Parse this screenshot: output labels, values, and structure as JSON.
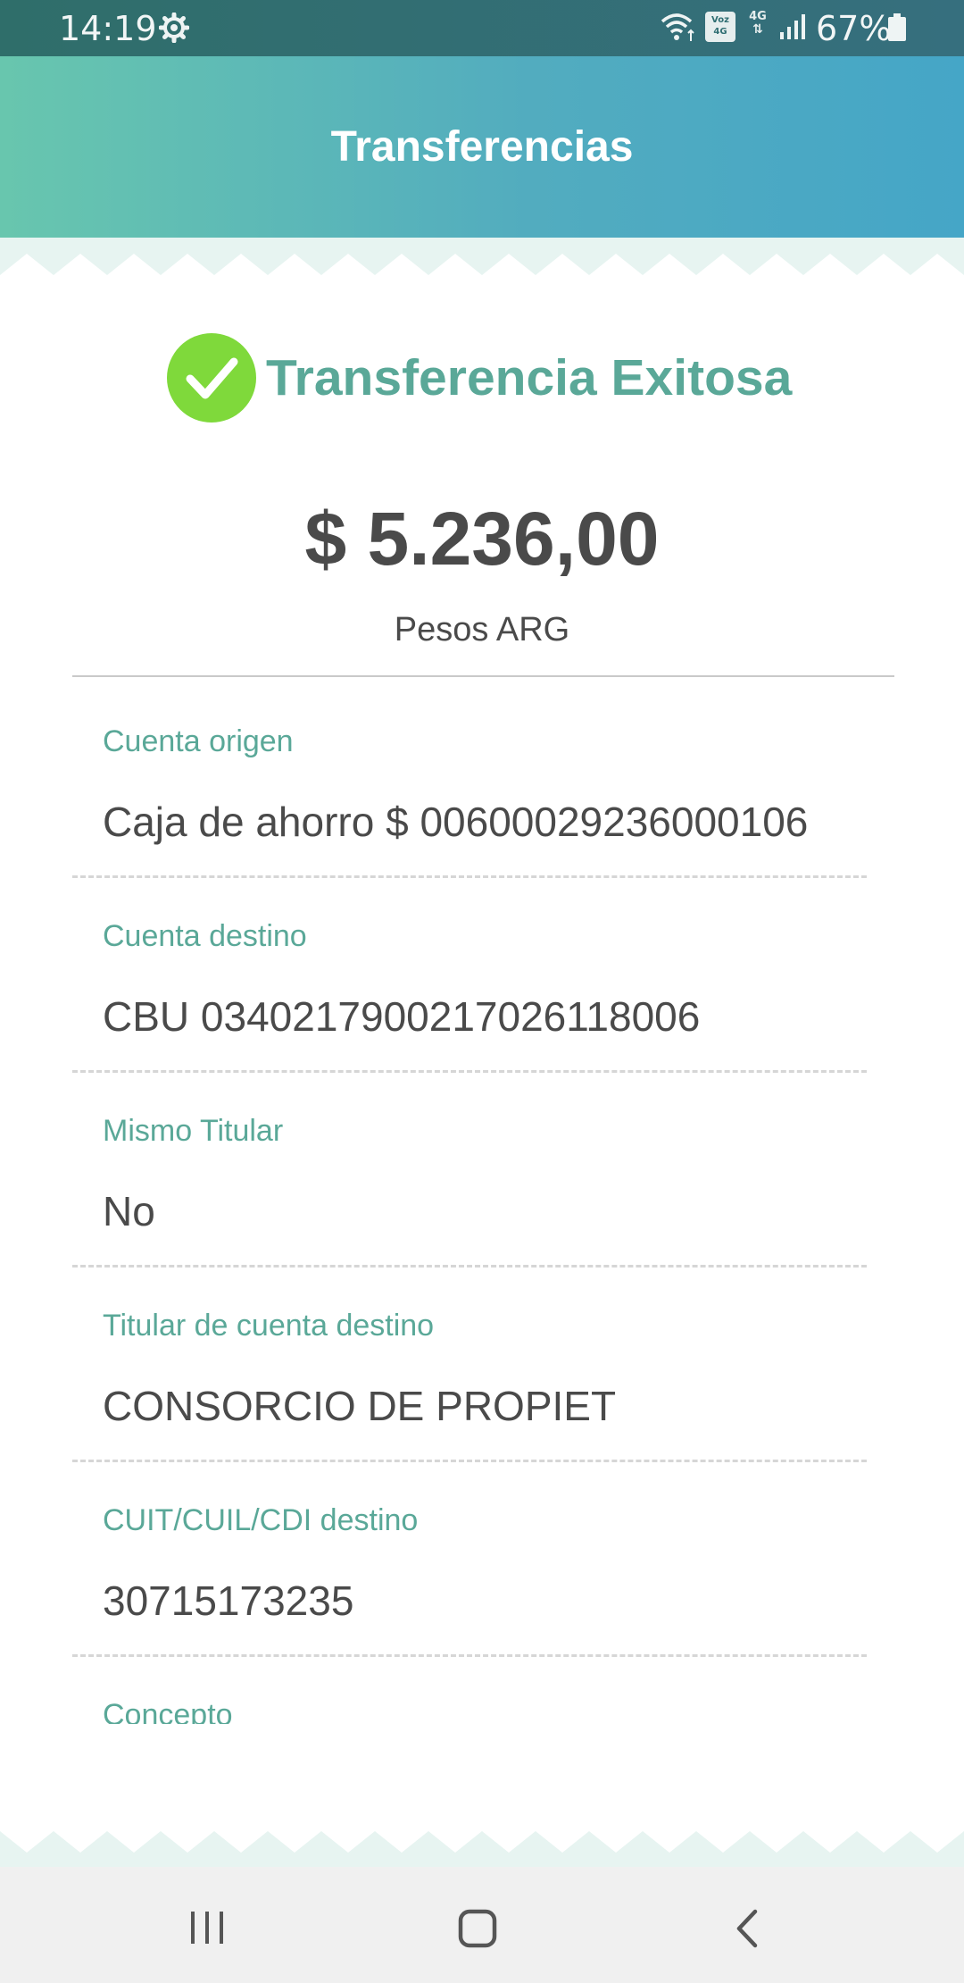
{
  "status_bar": {
    "time": "14:19",
    "battery": "67%",
    "volte_label": "Voz 4G",
    "network_label": "4G"
  },
  "header": {
    "title": "Transferencias"
  },
  "success": {
    "text": "Transferencia Exitosa",
    "icon": "check-circle-icon",
    "icon_color": "#7fd93b"
  },
  "amount": {
    "value": "$ 5.236,00",
    "currency": "Pesos ARG"
  },
  "fields": [
    {
      "label": "Cuenta origen",
      "value": "Caja de ahorro $ 00600029236000106"
    },
    {
      "label": "Cuenta destino",
      "value": "CBU 0340217900217026118006"
    },
    {
      "label": "Mismo Titular",
      "value": "No"
    },
    {
      "label": "Titular de cuenta destino",
      "value": "CONSORCIO DE PROPIET"
    },
    {
      "label": "CUIT/CUIL/CDI destino",
      "value": "30715173235"
    },
    {
      "label": "Concepto",
      "value": ""
    }
  ],
  "colors": {
    "accent": "#5aa898",
    "header_start": "#68c6ae",
    "header_end": "#45a6c7",
    "text": "#4a4a4a"
  }
}
